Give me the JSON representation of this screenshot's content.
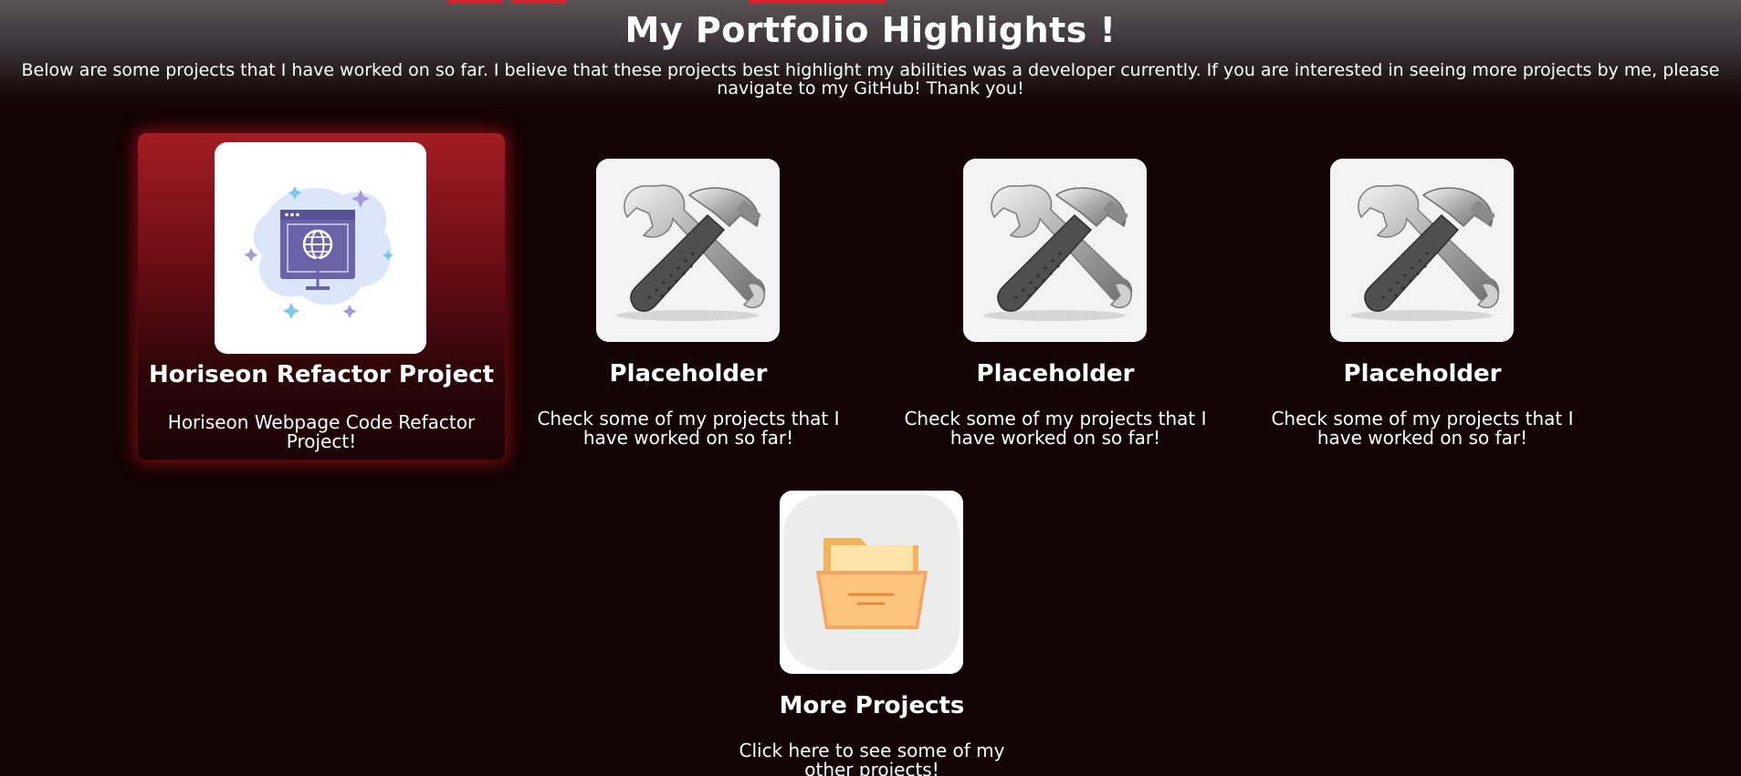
{
  "header": {
    "title": "My Portfolio Highlights !",
    "intro": "Below are some projects that I have worked on so far. I believe that these projects best highlight my abilities was a developer currently. If you are interested in seeing more projects by me, please navigate to my GitHub! Thank you!"
  },
  "colors": {
    "background": "#130304",
    "accent": "#d7212c",
    "active_card": "#a21c23"
  },
  "projects": [
    {
      "title": "Horiseon Refactor Project",
      "description": "Horiseon Webpage Code Refactor Project!",
      "icon": "web-globe-icon",
      "active": true
    },
    {
      "title": "Placeholder",
      "description": "Check some of my projects that I have worked on so far!",
      "icon": "tools-icon",
      "active": false
    },
    {
      "title": "Placeholder",
      "description": "Check some of my projects that I have worked on so far!",
      "icon": "tools-icon",
      "active": false
    },
    {
      "title": "Placeholder",
      "description": "Check some of my projects that I have worked on so far!",
      "icon": "tools-icon",
      "active": false
    },
    {
      "title": "More Projects",
      "description": "Click here to see some of my other projects!",
      "icon": "folder-icon",
      "active": false
    }
  ]
}
